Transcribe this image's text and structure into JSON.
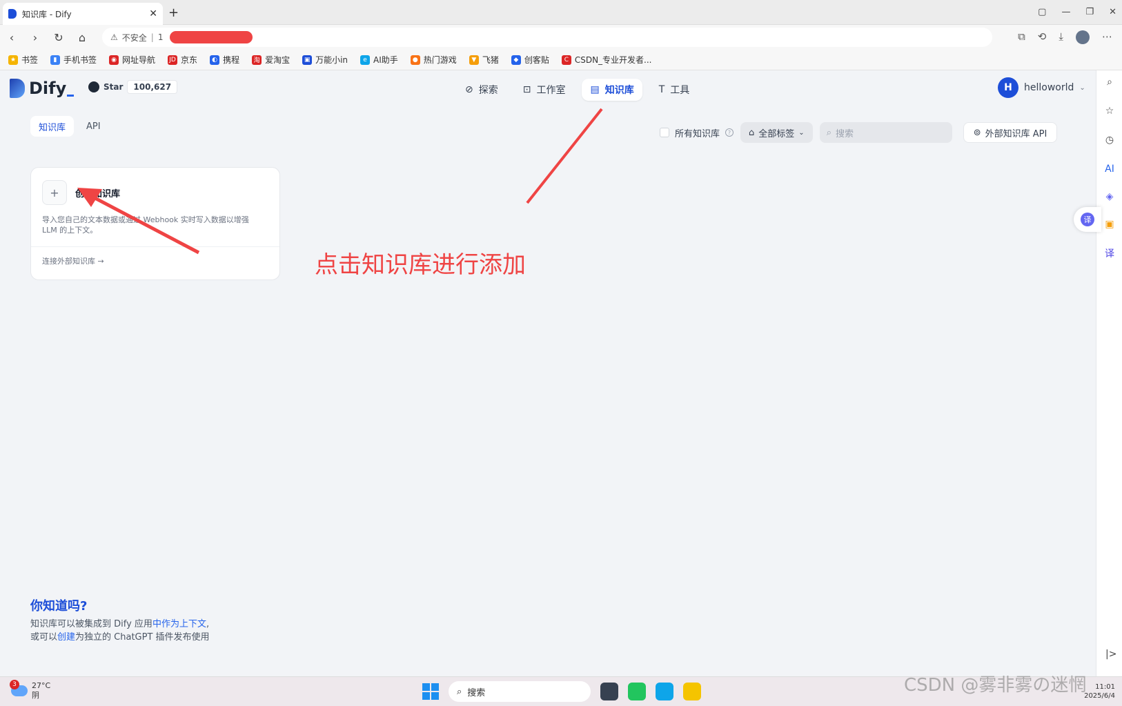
{
  "browser": {
    "tab_title": "知识库 - Dify",
    "security_label": "不安全",
    "url_prefix": "1",
    "bookmarks": [
      {
        "label": "书签",
        "color": "#f5b400",
        "glyph": "★"
      },
      {
        "label": "手机书签",
        "color": "#3b82f6",
        "glyph": "▮"
      },
      {
        "label": "网址导航",
        "color": "#dc2626",
        "glyph": "◉"
      },
      {
        "label": "京东",
        "color": "#dc2626",
        "glyph": "JD"
      },
      {
        "label": "携程",
        "color": "#2563eb",
        "glyph": "◐"
      },
      {
        "label": "爱淘宝",
        "color": "#dc2626",
        "glyph": "淘"
      },
      {
        "label": "万能小in",
        "color": "#1d4ed8",
        "glyph": "▣"
      },
      {
        "label": "AI助手",
        "color": "#0ea5e9",
        "glyph": "e"
      },
      {
        "label": "热门游戏",
        "color": "#f97316",
        "glyph": "●"
      },
      {
        "label": "飞猪",
        "color": "#f59e0b",
        "glyph": "▼"
      },
      {
        "label": "创客贴",
        "color": "#2563eb",
        "glyph": "◆"
      },
      {
        "label": "CSDN_专业开发者...",
        "color": "#dc2626",
        "glyph": "C"
      }
    ]
  },
  "app": {
    "logo_text": "Dify",
    "github": {
      "star_label": "Star",
      "count": "100,627"
    },
    "nav": [
      {
        "label": "探索",
        "icon": "compass-icon",
        "glyph": "⊘"
      },
      {
        "label": "工作室",
        "icon": "robot-icon",
        "glyph": "⊡"
      },
      {
        "label": "知识库",
        "icon": "book-icon",
        "glyph": "▤"
      },
      {
        "label": "工具",
        "icon": "hammer-icon",
        "glyph": "T"
      }
    ],
    "user": {
      "initial": "H",
      "name": "helloworld"
    },
    "subtabs": [
      "知识库",
      "API"
    ],
    "filters": {
      "all_kb_label": "所有知识库",
      "tags_label": "全部标签",
      "search_placeholder": "搜索",
      "external_api_label": "外部知识库 API"
    },
    "create_card": {
      "plus": "+",
      "title": "创建知识库",
      "desc_line1": "导入您自己的文本数据或通过 Webhook 实时写入数据以增强",
      "desc_line2": "LLM 的上下文。",
      "link_label": "连接外部知识库 →"
    },
    "annotation": "点击知识库进行添加",
    "tips": {
      "title": "你知道吗?",
      "line1_a": "知识库可以被集成到 Dify 应用",
      "line1_b": "中作为上下文",
      "line1_c": ",",
      "line2_a": "或可以",
      "line2_b": "创建",
      "line2_c": "为独立的 ChatGPT 插件发布使用"
    }
  },
  "taskbar": {
    "weather_badge": "3",
    "temperature": "27°C",
    "condition": "阴",
    "search_label": "搜索",
    "time": "11:01",
    "date": "2025/6/4"
  },
  "watermark": "CSDN @雾非雾の迷惘"
}
